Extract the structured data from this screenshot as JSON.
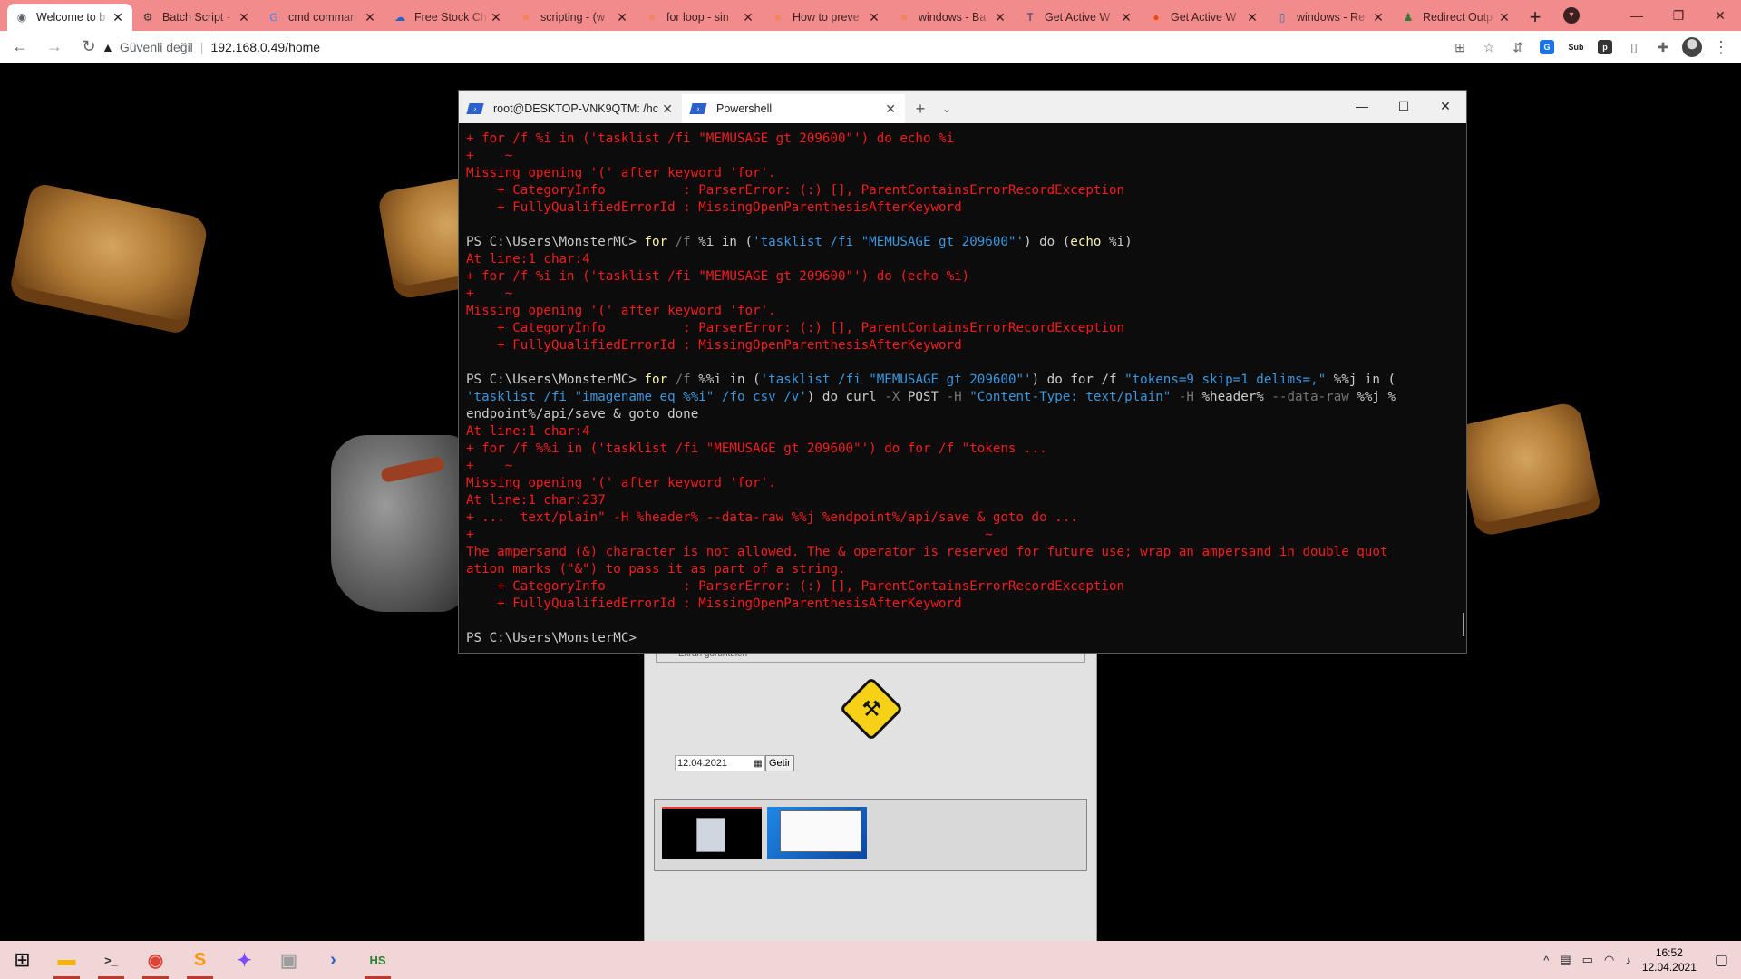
{
  "browser": {
    "tabs": [
      {
        "title": "Welcome to b",
        "active": true,
        "icon": "web-icon",
        "glyph": "◉",
        "color": "#5f6368"
      },
      {
        "title": "Batch Script -",
        "active": false,
        "icon": "batch-icon",
        "glyph": "⚙",
        "color": "#333333"
      },
      {
        "title": "cmd comman",
        "active": false,
        "icon": "google-icon",
        "glyph": "G",
        "color": "#4285f4"
      },
      {
        "title": "Free Stock Ch",
        "active": false,
        "icon": "cloud-icon",
        "glyph": "☁",
        "color": "#1e66c7"
      },
      {
        "title": "scripting - (w",
        "active": false,
        "icon": "stackoverflow-icon",
        "glyph": "≡",
        "color": "#f48024"
      },
      {
        "title": "for loop - sin",
        "active": false,
        "icon": "stackoverflow-icon",
        "glyph": "≡",
        "color": "#f48024"
      },
      {
        "title": "How to preve",
        "active": false,
        "icon": "stackoverflow-icon",
        "glyph": "≡",
        "color": "#f48024"
      },
      {
        "title": "windows - Ba",
        "active": false,
        "icon": "stackoverflow-icon",
        "glyph": "≡",
        "color": "#f48024"
      },
      {
        "title": "Get Active W",
        "active": false,
        "icon": "tn-icon",
        "glyph": "T",
        "color": "#1b3a5c"
      },
      {
        "title": "Get Active W",
        "active": false,
        "icon": "reddit-icon",
        "glyph": "●",
        "color": "#ff4500"
      },
      {
        "title": "windows - Re",
        "active": false,
        "icon": "superuser-icon",
        "glyph": "▯",
        "color": "#2b7bb9"
      },
      {
        "title": "Redirect Outp",
        "active": false,
        "icon": "person-icon",
        "glyph": "♟",
        "color": "#2e7d32"
      }
    ],
    "new_tab": "+",
    "security_label": "Güvenli değil",
    "url": "192.168.0.49/home",
    "tab_search": "▾",
    "minimize": "—",
    "restore": "❐",
    "close": "✕",
    "back": "←",
    "forward": "→",
    "reload": "↻",
    "translate": "⊞",
    "star": "☆",
    "extensions": "✚",
    "ext_sub": "Sub",
    "ext_p": "p",
    "menu": "⋮"
  },
  "page": {
    "panel_top_text": "Ekran görüntüleri",
    "date_value": "12.04.2021",
    "date_icon": "▦",
    "getir_label": "Getir",
    "uc_icon": "⚒"
  },
  "terminal": {
    "tabs": [
      {
        "title": "root@DESKTOP-VNK9QTM: /hc",
        "active": false
      },
      {
        "title": "Powershell",
        "active": true
      }
    ],
    "plus": "+",
    "dropdown": "⌄",
    "minimize": "—",
    "maximize": "☐",
    "close": "✕",
    "lines": [
      {
        "type": "err",
        "text": "+ for /f %i in ('tasklist /fi \"MEMUSAGE gt 209600\"') do echo %i"
      },
      {
        "type": "err",
        "text": "+    ~"
      },
      {
        "type": "err",
        "text": "Missing opening '(' after keyword 'for'."
      },
      {
        "type": "err",
        "text": "    + CategoryInfo          : ParserError: (:) [], ParentContainsErrorRecordException"
      },
      {
        "type": "err",
        "text": "    + FullyQualifiedErrorId : MissingOpenParenthesisAfterKeyword"
      },
      {
        "type": "blank",
        "text": ""
      },
      {
        "type": "cmd",
        "parts": [
          {
            "c": "prm",
            "t": "PS C:\\Users\\MonsterMC> "
          },
          {
            "c": "cmd",
            "t": "for "
          },
          {
            "c": "par",
            "t": "/f "
          },
          {
            "c": "prm",
            "t": "%i in ("
          },
          {
            "c": "str",
            "t": "'tasklist /fi \"MEMUSAGE gt 209600\"'"
          },
          {
            "c": "prm",
            "t": ") do ("
          },
          {
            "c": "cmd",
            "t": "echo "
          },
          {
            "c": "prm",
            "t": "%i)"
          }
        ]
      },
      {
        "type": "err",
        "text": "At line:1 char:4"
      },
      {
        "type": "err",
        "text": "+ for /f %i in ('tasklist /fi \"MEMUSAGE gt 209600\"') do (echo %i)"
      },
      {
        "type": "err",
        "text": "+    ~"
      },
      {
        "type": "err",
        "text": "Missing opening '(' after keyword 'for'."
      },
      {
        "type": "err",
        "text": "    + CategoryInfo          : ParserError: (:) [], ParentContainsErrorRecordException"
      },
      {
        "type": "err",
        "text": "    + FullyQualifiedErrorId : MissingOpenParenthesisAfterKeyword"
      },
      {
        "type": "blank",
        "text": ""
      },
      {
        "type": "cmd",
        "parts": [
          {
            "c": "prm",
            "t": "PS C:\\Users\\MonsterMC> "
          },
          {
            "c": "cmd",
            "t": "for "
          },
          {
            "c": "par",
            "t": "/f "
          },
          {
            "c": "prm",
            "t": "%%i in ("
          },
          {
            "c": "str",
            "t": "'tasklist /fi \"MEMUSAGE gt 209600\"'"
          },
          {
            "c": "prm",
            "t": ") do for /f "
          },
          {
            "c": "str",
            "t": "\"tokens=9 skip=1 delims=,\""
          },
          {
            "c": "prm",
            "t": " %%j in ("
          }
        ]
      },
      {
        "type": "cmd",
        "parts": [
          {
            "c": "str",
            "t": "'tasklist /fi \"imagename eq %%i\" /fo csv /v'"
          },
          {
            "c": "prm",
            "t": ") do curl "
          },
          {
            "c": "par",
            "t": "-X "
          },
          {
            "c": "prm",
            "t": "POST "
          },
          {
            "c": "par",
            "t": "-H "
          },
          {
            "c": "str",
            "t": "\"Content-Type: text/plain\""
          },
          {
            "c": "par",
            "t": " -H "
          },
          {
            "c": "prm",
            "t": "%header% "
          },
          {
            "c": "par",
            "t": "--data-raw "
          },
          {
            "c": "prm",
            "t": "%%j %"
          }
        ]
      },
      {
        "type": "cmd",
        "parts": [
          {
            "c": "prm",
            "t": "endpoint%/api/save & goto done"
          }
        ]
      },
      {
        "type": "err",
        "text": "At line:1 char:4"
      },
      {
        "type": "err",
        "text": "+ for /f %%i in ('tasklist /fi \"MEMUSAGE gt 209600\"') do for /f \"tokens ..."
      },
      {
        "type": "err",
        "text": "+    ~"
      },
      {
        "type": "err",
        "text": "Missing opening '(' after keyword 'for'."
      },
      {
        "type": "err",
        "text": "At line:1 char:237"
      },
      {
        "type": "err",
        "text": "+ ...  text/plain\" -H %header% --data-raw %%j %endpoint%/api/save & goto do ..."
      },
      {
        "type": "err",
        "text": "+                                                                  ~"
      },
      {
        "type": "err",
        "text": "The ampersand (&) character is not allowed. The & operator is reserved for future use; wrap an ampersand in double quot"
      },
      {
        "type": "err",
        "text": "ation marks (\"&\") to pass it as part of a string."
      },
      {
        "type": "err",
        "text": "    + CategoryInfo          : ParserError: (:) [], ParentContainsErrorRecordException"
      },
      {
        "type": "err",
        "text": "    + FullyQualifiedErrorId : MissingOpenParenthesisAfterKeyword"
      },
      {
        "type": "blank",
        "text": ""
      },
      {
        "type": "prompt",
        "text": "PS C:\\Users\\MonsterMC>"
      }
    ]
  },
  "taskbar": {
    "start": "⊞",
    "apps": [
      {
        "name": "file-explorer-icon",
        "glyph": "▬",
        "color": "#f4b400",
        "active": true
      },
      {
        "name": "terminal-icon",
        "glyph": ">_",
        "color": "#333333",
        "active": true
      },
      {
        "name": "chrome-icon",
        "glyph": "◉",
        "color": "#db4437",
        "active": true
      },
      {
        "name": "sublime-icon",
        "glyph": "S",
        "color": "#ff9800",
        "active": true
      },
      {
        "name": "gamepad-icon",
        "glyph": "✦",
        "color": "#7c4dff",
        "active": false
      },
      {
        "name": "photos-icon",
        "glyph": "▣",
        "color": "#9e9e9e",
        "active": false
      },
      {
        "name": "powershell-icon",
        "glyph": "›",
        "color": "#2a62c9",
        "active": false
      },
      {
        "name": "hs-icon",
        "glyph": "HS",
        "color": "#2e7d32",
        "active": true
      }
    ],
    "tray": [
      "^",
      "▤",
      "▭",
      "◠",
      "♪"
    ],
    "time": "16:52",
    "date": "12.04.2021",
    "notifications": "▢"
  }
}
